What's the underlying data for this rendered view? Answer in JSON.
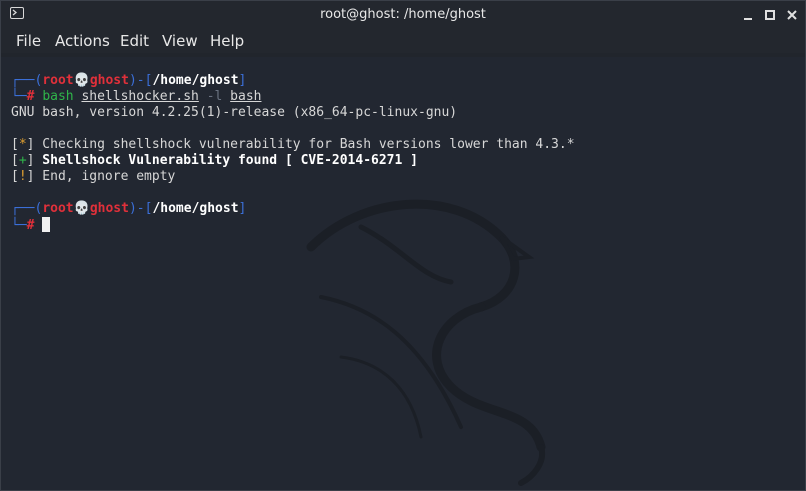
{
  "window": {
    "title": "root@ghost: /home/ghost"
  },
  "menu": {
    "items": [
      "File",
      "Actions",
      "Edit",
      "View",
      "Help"
    ]
  },
  "terminal": {
    "prompt1": {
      "corner_top": "┌──(",
      "user": "root",
      "skull": "💀",
      "host": "ghost",
      "sep": ")-[",
      "cwd": "/home/ghost",
      "close": "]",
      "corner_bottom": "└─",
      "hash": "#",
      "cmd_bash": "bash",
      "cmd_script": "shellshocker.sh",
      "cmd_flag": "-l",
      "cmd_arg": "bash"
    },
    "output": {
      "version_line": "GNU bash, version 4.2.25(1)-release (x86_64-pc-linux-gnu)",
      "check_prefix": "[",
      "check_mark": "*",
      "check_suffix": "]",
      "check_text": " Checking shellshock vulnerability for Bash versions lower than 4.3.*",
      "found_prefix": "[",
      "found_mark": "+",
      "found_suffix": "]",
      "found_text": " Shellshock Vulnerability found [ CVE-2014-6271 ]",
      "end_prefix": "[",
      "end_mark": "!",
      "end_suffix": "]",
      "end_text": " End, ignore empty"
    },
    "prompt2": {
      "corner_top": "┌──(",
      "user": "root",
      "skull": "💀",
      "host": "ghost",
      "sep": ")-[",
      "cwd": "/home/ghost",
      "close": "]",
      "corner_bottom": "└─",
      "hash": "#"
    }
  },
  "colors": {
    "prompt_frame": "#3b6fd8",
    "user_host": "#e0303a",
    "command": "#2fb54a",
    "flag": "#6b7382",
    "mark_star": "#e0a030",
    "mark_plus": "#2fb54a",
    "mark_bang": "#e0a030"
  },
  "icons": {
    "app": "terminal-icon",
    "minimize": "minimize-icon",
    "maximize": "maximize-icon",
    "close": "close-icon",
    "background": "kali-dragon-logo"
  }
}
